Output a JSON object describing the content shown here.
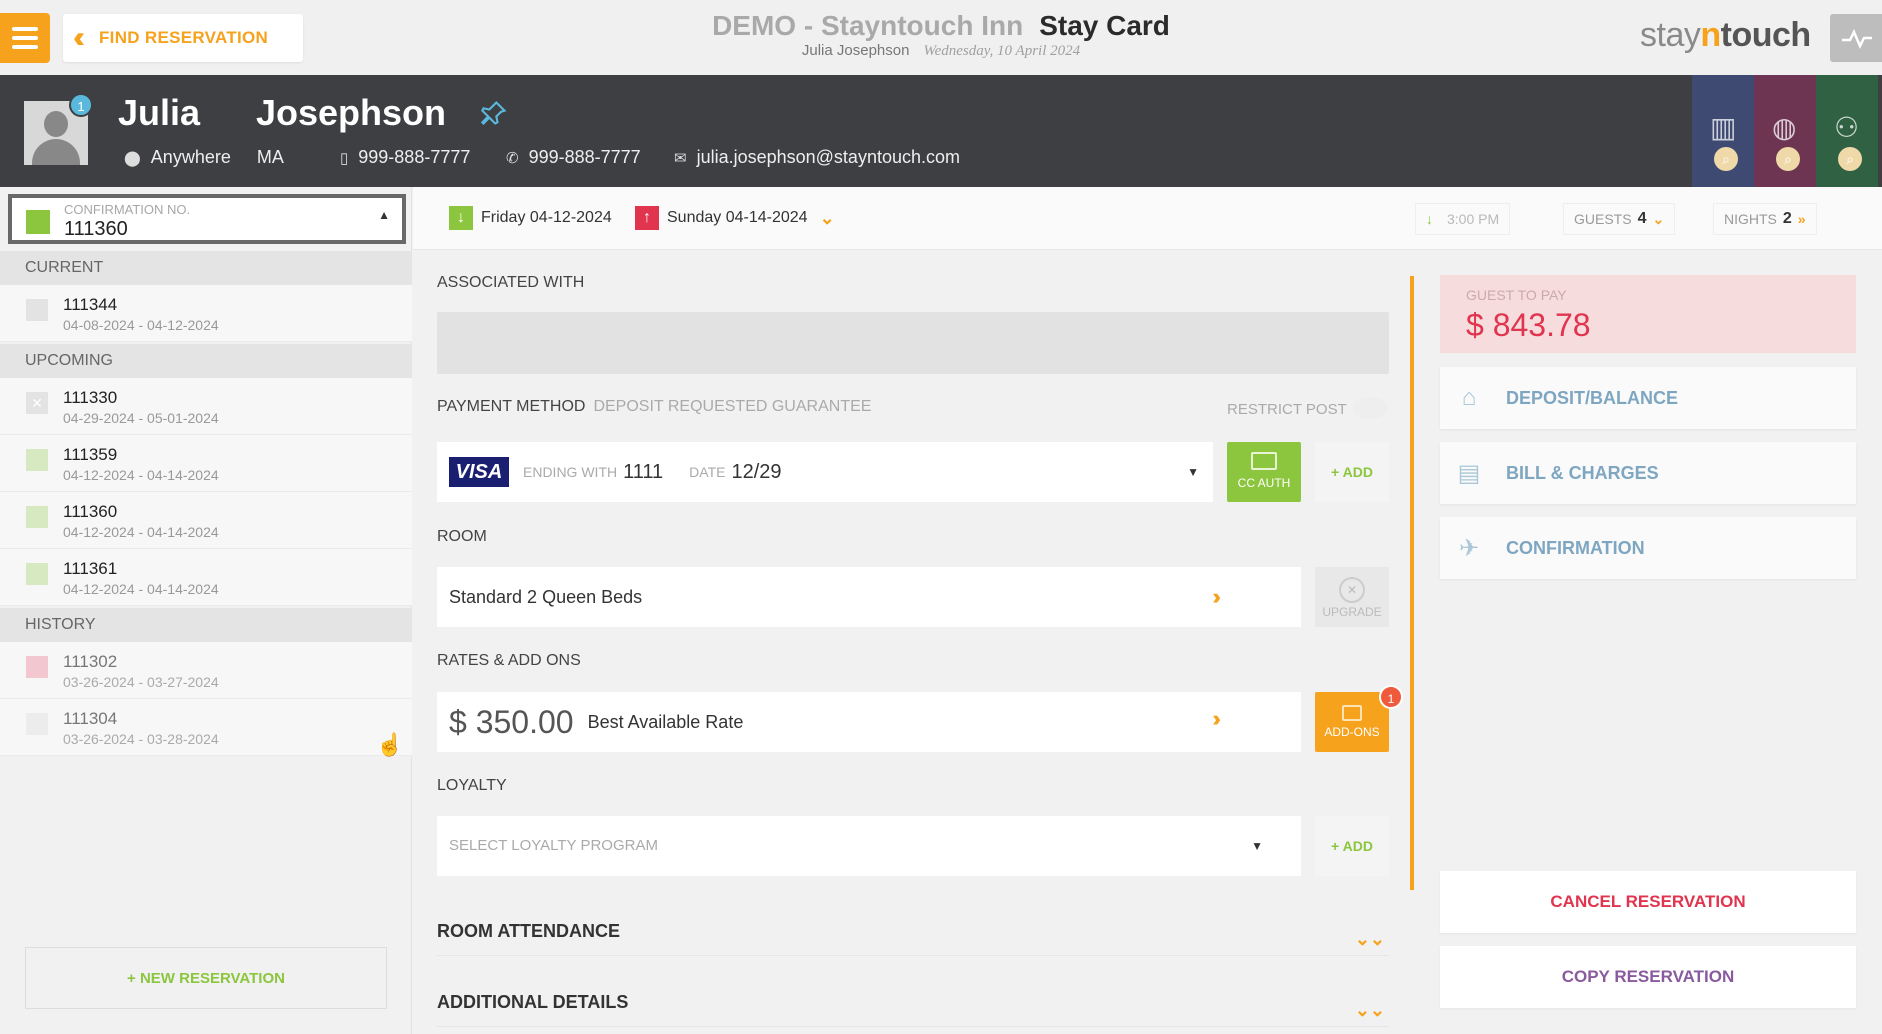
{
  "topbar": {
    "find_reservation": "FIND RESERVATION",
    "hotel_name": "DEMO - Stayntouch Inn",
    "page_title": "Stay Card",
    "user_name": "Julia Josephson",
    "date": "Wednesday, 10 April 2024",
    "logo_prefix": "stay",
    "logo_n": "n",
    "logo_suffix": "touch"
  },
  "guest": {
    "first_name": "Julia",
    "last_name": "Josephson",
    "badge_count": "1",
    "city": "Anywhere",
    "state": "MA",
    "mobile": "999-888-7777",
    "phone": "999-888-7777",
    "email": "julia.josephson@stayntouch.com"
  },
  "sidebar": {
    "confirmation_label": "CONFIRMATION NO.",
    "confirmation_value": "111360",
    "sections": {
      "current": "CURRENT",
      "upcoming": "UPCOMING",
      "history": "HISTORY"
    },
    "current": [
      {
        "number": "111344",
        "dates": "04-08-2024 - 04-12-2024",
        "color": "#e3e3e3"
      }
    ],
    "upcoming": [
      {
        "number": "111330",
        "dates": "04-29-2024 - 05-01-2024",
        "color": "#e3e3e3"
      },
      {
        "number": "111359",
        "dates": "04-12-2024 - 04-14-2024",
        "color": "#d6e9c1"
      },
      {
        "number": "111360",
        "dates": "04-12-2024 - 04-14-2024",
        "color": "#d6e9c1"
      },
      {
        "number": "111361",
        "dates": "04-12-2024 - 04-14-2024",
        "color": "#d6e9c1"
      }
    ],
    "history": [
      {
        "number": "111302",
        "dates": "03-26-2024 - 03-27-2024",
        "color": "#f3c7cf"
      },
      {
        "number": "111304",
        "dates": "03-26-2024 - 03-28-2024",
        "color": "#ececec"
      }
    ],
    "new_reservation": "+ NEW RESERVATION"
  },
  "datebar": {
    "arrival": "Friday 04-12-2024",
    "departure": "Sunday 04-14-2024",
    "arrival_time": "3:00 PM",
    "guests_label": "GUESTS",
    "guests_value": "4",
    "nights_label": "NIGHTS",
    "nights_value": "2"
  },
  "main": {
    "associated_with": "ASSOCIATED WITH",
    "payment_method": "PAYMENT METHOD",
    "payment_note": "DEPOSIT REQUESTED GUARANTEE",
    "restrict_post": "RESTRICT POST",
    "card_brand": "VISA",
    "ending_with_label": "ENDING WITH",
    "ending_with_value": "1111",
    "date_label": "DATE",
    "date_value": "12/29",
    "cc_auth": "CC AUTH",
    "add": "+ ADD",
    "room_label": "ROOM",
    "room_type": "Standard 2 Queen Beds",
    "upgrade": "UPGRADE",
    "rates_label": "RATES & ADD ONS",
    "rate_amount": "$ 350.00",
    "rate_name": "Best Available Rate",
    "addons": "ADD-ONS",
    "addons_count": "1",
    "loyalty_label": "LOYALTY",
    "loyalty_placeholder": "SELECT LOYALTY PROGRAM",
    "loyalty_add": "+ ADD",
    "room_attendance": "ROOM ATTENDANCE",
    "additional_details": "ADDITIONAL DETAILS"
  },
  "right": {
    "guest_to_pay_label": "GUEST TO PAY",
    "guest_to_pay_value": "$ 843.78",
    "deposit_balance": "DEPOSIT/BALANCE",
    "bill_charges": "BILL & CHARGES",
    "confirmation": "CONFIRMATION",
    "cancel_reservation": "CANCEL RESERVATION",
    "copy_reservation": "COPY RESERVATION"
  },
  "colors": {
    "accent": "#f6a21d",
    "green": "#8cc63e",
    "header_dark": "#3d3f42",
    "due": "#e0344f",
    "cancel": "#e0344f",
    "copy": "#8a5a9e"
  },
  "header_tiles": [
    {
      "icon": "hotel-building-icon",
      "color": "#3f4a72"
    },
    {
      "icon": "globe-icon",
      "color": "#6e3553"
    },
    {
      "icon": "group-icon",
      "color": "#2f6142"
    }
  ]
}
